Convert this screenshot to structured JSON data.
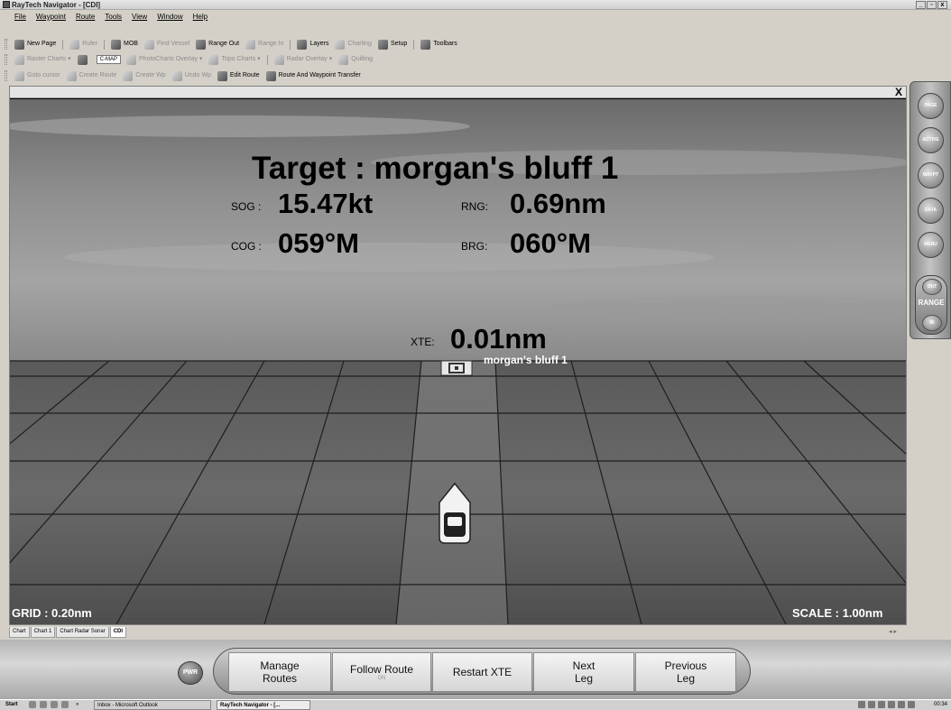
{
  "window": {
    "title": "RayTech Navigator - [CDI]"
  },
  "menu": [
    "File",
    "Waypoint",
    "Route",
    "Tools",
    "View",
    "Window",
    "Help"
  ],
  "toolbar1": [
    {
      "label": "New Page",
      "icon": "new-page-icon"
    },
    {
      "label": "Ruler",
      "icon": "ruler-icon",
      "disabled": true
    },
    {
      "label": "MOB",
      "icon": "mob-icon"
    },
    {
      "label": "Find Vessel",
      "icon": "find-vessel-icon",
      "disabled": true
    },
    {
      "label": "Range Out",
      "icon": "range-out-icon"
    },
    {
      "label": "Range In",
      "icon": "range-in-icon",
      "disabled": true
    },
    {
      "label": "Layers",
      "icon": "layers-icon"
    },
    {
      "label": "Charting",
      "icon": "charting-icon",
      "disabled": true
    },
    {
      "label": "Setup",
      "icon": "setup-icon"
    },
    {
      "label": "Toolbars",
      "icon": "toolbars-icon"
    }
  ],
  "toolbar2": {
    "raster": "Raster Charts",
    "cmap": "C-MAP",
    "photo": "PhotoCharts Overlay",
    "topo": "Topo Charts",
    "radar": "Radar Overlay",
    "quilting": "Quilting"
  },
  "toolbar3": [
    {
      "label": "Goto cursor",
      "icon": "goto-cursor-icon",
      "disabled": true
    },
    {
      "label": "Create Route",
      "icon": "create-route-icon",
      "disabled": true
    },
    {
      "label": "Create Wp",
      "icon": "create-waypoint-icon",
      "disabled": true
    },
    {
      "label": "Undo Wp",
      "icon": "undo-waypoint-icon",
      "disabled": true
    },
    {
      "label": "Edit Route",
      "icon": "edit-route-icon"
    },
    {
      "label": "Route And Waypoint Transfer",
      "icon": "transfer-icon"
    }
  ],
  "cdi": {
    "target": "Target : morgan's bluff 1",
    "sog_label": "SOG :",
    "sog": "15.47kt",
    "rng_label": "RNG:",
    "rng": "0.69nm",
    "cog_label": "COG :",
    "cog": "059°M",
    "brg_label": "BRG:",
    "brg": "060°M",
    "xte_label": "XTE:",
    "xte": "0.01nm",
    "waypoint_name": "morgan's bluff 1",
    "grid": "GRID : 0.20nm",
    "scale": "SCALE : 1.00nm"
  },
  "side_buttons": [
    "PAGE",
    "ACTIVE",
    "WAYPT",
    "DATA",
    "MENU"
  ],
  "range": {
    "label": "RANGE",
    "out": "OUT",
    "in": "IN"
  },
  "close_label": "X",
  "doc_tabs": [
    "Chart",
    "Chart 1",
    "Chart Radar Sonar",
    "CDI"
  ],
  "controls": {
    "pwr": "PWR",
    "buttons": [
      {
        "label": "Manage\nRoutes"
      },
      {
        "label": "Follow Route",
        "sub": "ON"
      },
      {
        "label": "Restart XTE"
      },
      {
        "label": "Next\nLeg"
      },
      {
        "label": "Previous\nLeg"
      }
    ]
  },
  "taskbar": {
    "start": "Start",
    "tasks": [
      "Inbox - Microsoft Outlook",
      "RayTech Navigator - [..."
    ],
    "more": "»",
    "clock": "00:34"
  }
}
